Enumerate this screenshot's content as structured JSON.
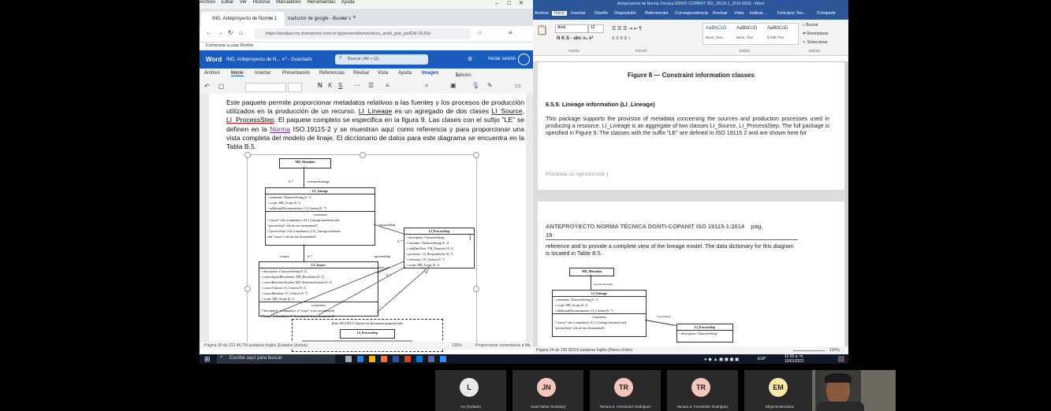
{
  "browser": {
    "menu": [
      "Archivo",
      "Editar",
      "Ver",
      "Historial",
      "Marcadores",
      "Herramientas",
      "Ayuda"
    ],
    "tabs": [
      {
        "title": "ING. Anteproyecto de Norma 1",
        "close": "×"
      },
      {
        "title": "traductor de google - Buscar c",
        "close": "×"
      }
    ],
    "new_tab": "+",
    "url": "https://analipa-my.sharepoint.com/:w:/g/personal/emendoza_anali_gob_pa/EW-IZU0w",
    "bookmark": "Comenzar a usar Firefox"
  },
  "word_online": {
    "app": "Word",
    "doc_title": "ING. Anteproyecto de N... ∧⁰ - Guardado",
    "search_placeholder": "Buscar (Alt + Q)",
    "signin": "Iniciar sesión",
    "ribbon_tabs": [
      "Archivo",
      "Inicio",
      "Insertar",
      "Presentación",
      "Referencias",
      "Revisar",
      "Vista",
      "Ayuda",
      "Imagen"
    ],
    "edit_mode": "Edición",
    "para_1": "Este paquete permite proporcionar metadatos relativos a las fuentes y los procesos de producción utilizados en la producción de un recurso. ",
    "li_lineage": "LI_Lineage",
    "para_2": " es un agregado de dos clases ",
    "li_source": "LI_Source",
    "comma": ", ",
    "li_process": "LI_ProcessStep",
    "para_3": ". El paquete completo se especifica en la figura 9. Las clases con el sufijo \"LE\" se definen en  la ",
    "norma": "Norma",
    "para_4": " ISO.19115-2 y se muestran aquí como referencia y para proporcionar una vista completa del modelo de linaje. El diccionario de datos para este diagrama se encuentra en la Tabla B.5.",
    "status": "Página 30 de 212   44,756 palabras   Inglés (Estados Unidos)",
    "zoom": "130%",
    "feedback": "Proporcionar comentarios a Microsoft"
  },
  "uml": {
    "md_metadata": "MD_Metadata",
    "role_resource": "+resourceLineage",
    "mult_0n": "0..*",
    "li_lineage": {
      "title": "LI_Lineage",
      "attrs": [
        "+ statement: CharacterString [0..1]",
        "+ scope: MD_Scope [0..1]",
        "+ additionalDocumentation: CI_Citation [0..*]"
      ],
      "constraints": "constraints",
      "c1": "{\"source\" role is mandatory if LI_Lineage.statement and",
      "c2": "\"processStep\" role are not documented}",
      "c3": "{\"processStep\" role is mandatory if LI_Lineage.statement",
      "c4": "and \"source\" role are not documented}"
    },
    "role_process": "+processStep",
    "role_source": "+source",
    "li_processstep": {
      "title": "LI_ProcessStep",
      "attrs": [
        "+ description: CharacterString",
        "+ rationale: CharacterString [0..1]",
        "+ stepDateTime: TM_Primitive [0..1]",
        "+ processor: CI_Responsibility [0..*]",
        "+ reference: CI_Citation [0..*]",
        "+ scope: MD_Scope [0..1]"
      ]
    },
    "li_source": {
      "title": "LI_Source",
      "attrs": [
        "+ description: CharacterString [0..1]",
        "+ sourceSpatialResolution: MD_Resolution [0..1]",
        "+ sourceReferenceSystem: MD_ReferenceSystem [0..1]",
        "+ sourceCitation: CI_Citation [0..1]",
        "+ sourceMetadata: CI_Citation [0..*]",
        "+ scope: MD_Scope [0..1]"
      ],
      "constraints": "constraints",
      "c1": "{\"description\" is mandatory if \"scope\" is not documented}",
      "c2": "{\"scope\" is mandatory if \"description\" is not documented}"
    },
    "from_iso": "From ISO 19115-2 shown for information purposes only",
    "li_processstep2": "LI_ProcessStep"
  },
  "word_desktop": {
    "title": "Anteproyecto de Norma Técnica DGNTI-COPANIT ISO_19115-1_2014 (003) - Word",
    "tabs": [
      "Archivo",
      "Inicio",
      "Insertar",
      "Diseño",
      "Disposición",
      "Referencias",
      "Correspondencia",
      "Revisar",
      "Vista",
      "Indicar...",
      "Feliciano Ten...",
      "Compartir"
    ],
    "font": "Arial",
    "size": "12",
    "styles": [
      "AaBbCcD",
      "AaBbCcD",
      "AaBbCcD"
    ],
    "style_names": [
      "Base_Hea...",
      "Base_Text",
      "¶ Bibli Text"
    ],
    "find": "Buscar",
    "replace": "Reemplazar",
    "select": "Seleccionar",
    "groups": [
      "Fuente",
      "Párrafo",
      "Estilos",
      "Edición"
    ],
    "fig8": "Figure 8 — Constraint information classes",
    "heading": "6.5.5. Lineage information (LI_Lineage)",
    "para": "This package supports the provision of metadata concerning the sources and production processes used in producing a resource. LI_Lineage is an aggregate of two classes LI_Source, LI_ProcessStep. The full package is specified in Figure 9. The classes with the suffix \"LE\" are defined in ISO 19115 2 and are shown here for",
    "footer": "Prohibida su reproducción ]",
    "header2": "ANTEPROYECTO NORMA TÉCNICA DGNTI-COPANIT ISO 19115-1:2014",
    "pag": "pág.",
    "pagnum": "18",
    "para2": "reference and to provide a complete view of the lineage model. The data dictionary for this diagram is located in Table B.5.",
    "status": "Página 24 de 199   35315 palabras   Inglés (Reino Unido)",
    "zoom": "120%"
  },
  "taskbar": {
    "search": "Escribe aquí para buscar",
    "lang": "ESP",
    "time": "11:03 a. m.",
    "date": "10/01/2021"
  },
  "participants": [
    {
      "initials": "L",
      "name": "Ivy (Invitado)",
      "color": "#e8e8e8"
    },
    {
      "initials": "JN",
      "name": "Josef Núñez (Invitado)",
      "color": "#f3c6bd"
    },
    {
      "initials": "TR",
      "name": "Tamara E. Fernández Rodríguez",
      "color": "#f3c6bd"
    },
    {
      "initials": "TR",
      "name": "Tamara E. Fernández Rodríguez",
      "color": "#f3c6bd"
    },
    {
      "initials": "EM",
      "name": "Efigenia Mendoza",
      "color": "#f7e8a6"
    }
  ],
  "colors": {
    "word_blue": "#185abd",
    "word_desktop_blue": "#2b579a",
    "link_purple": "#6b2fb3"
  }
}
